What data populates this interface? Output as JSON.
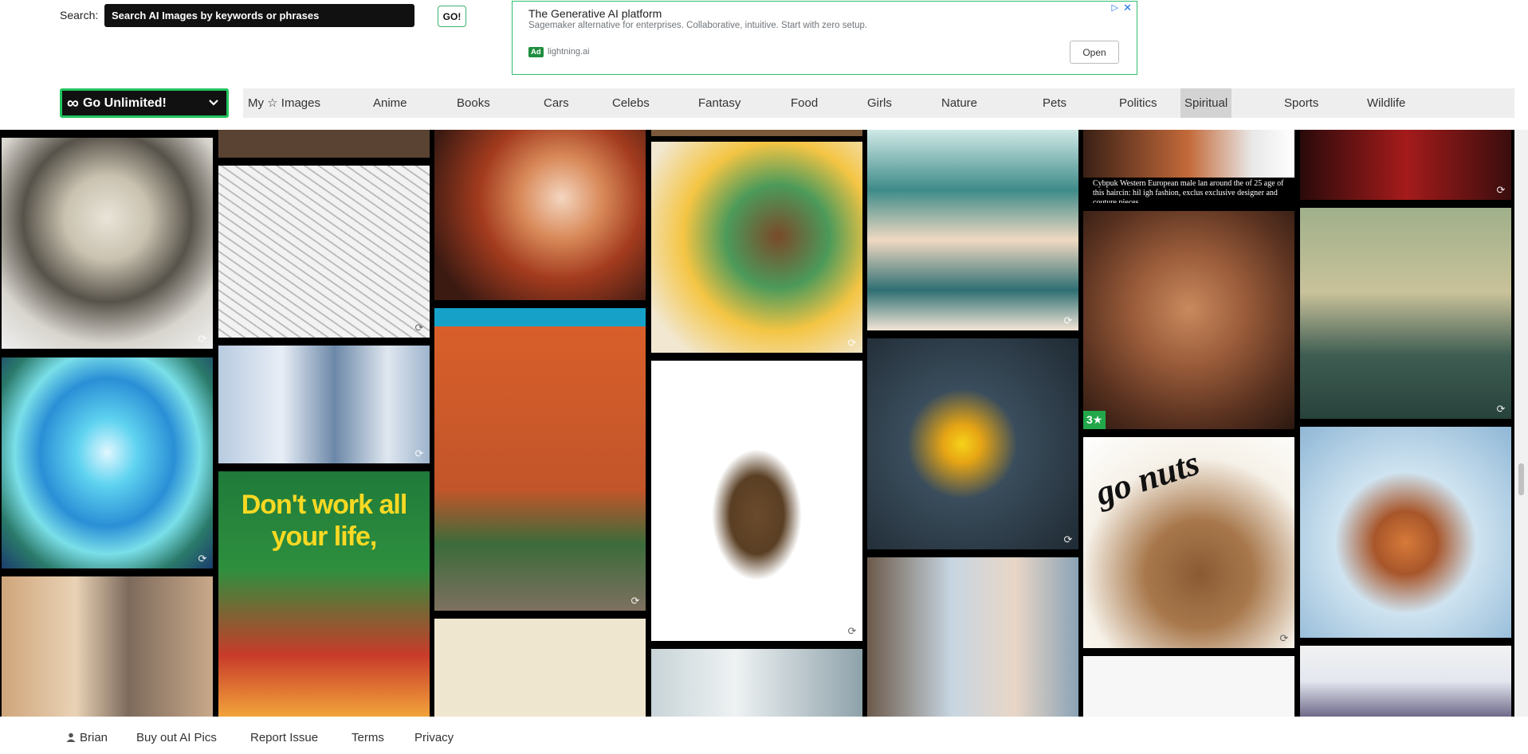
{
  "search": {
    "label": "Search:",
    "placeholder": "Search AI Images by keywords or phrases",
    "button": "GO!"
  },
  "ad": {
    "title": "The Generative AI platform",
    "description": "Sagemaker alternative for enterprises. Collaborative, intuitive. Start with zero setup.",
    "badge": "Ad",
    "domain": "lightning.ai",
    "button": "Open",
    "choices_icon": "adchoices-icon",
    "close_icon": "close-icon"
  },
  "nav": {
    "unlimited_icon": "∞",
    "unlimited_label": "Go Unlimited!",
    "categories": [
      "My ☆ Images",
      "Anime",
      "Books",
      "Cars",
      "Celebs",
      "Fantasy",
      "Food",
      "Girls",
      "Nature",
      "Pets",
      "Politics",
      "Spiritual",
      "Sports",
      "Wildlife"
    ],
    "active": "Spiritual"
  },
  "images": {
    "poster_text": "Don't work all your life,",
    "caption_text": "Cybpuk Western European male lan around the of 25 age of this haircin: hil igh fashion, exclus exclusive designer and couture pieces.",
    "nuts_text": "go nuts",
    "stars_badge": "3★"
  },
  "footer": {
    "user": "Brian",
    "links": [
      "Buy out AI Pics",
      "Report Issue",
      "Terms",
      "Privacy"
    ]
  },
  "colors": {
    "accent": "#22c55e",
    "nav_bg": "#eeeeee",
    "active_tab": "#d3d3d3",
    "grid_bg": "#000000"
  }
}
